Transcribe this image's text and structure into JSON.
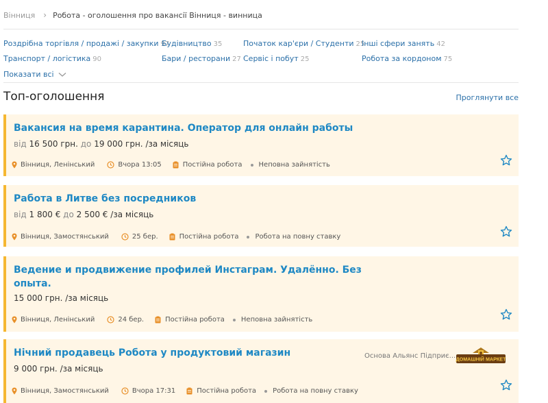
{
  "breadcrumb": {
    "city": "Вінниця",
    "current": "Робота - оголошення про вакансії Вінниця - винница"
  },
  "categories": [
    {
      "name": "Роздрібна торгівля / продажі / закупки",
      "count": "97"
    },
    {
      "name": "Будівництво",
      "count": "35"
    },
    {
      "name": "Початок кар'єри / Студенти",
      "count": "25"
    },
    {
      "name": "Інші сфери занять",
      "count": "42"
    },
    {
      "name": "Транспорт / логістика",
      "count": "90"
    },
    {
      "name": "Бари / ресторани",
      "count": "27"
    },
    {
      "name": "Сервіс і побут",
      "count": "25"
    },
    {
      "name": "Робота за кордоном",
      "count": "75"
    }
  ],
  "show_all_label": "Показати всі",
  "section": {
    "title": "Топ-оголошення",
    "view_all": "Проглянути все"
  },
  "listings": [
    {
      "title": "Вакансия на время карантина. Оператор для онлайн работы",
      "price_from_label": "від",
      "price_from": "16 500 грн.",
      "price_to_label": "до",
      "price_to": "19 000 грн.",
      "price_period": "/за місяць",
      "location": "Вінниця, Ленінський",
      "time": "Вчора 13:05",
      "job_type": "Постійна робота",
      "employment": "Неповна зайнятість"
    },
    {
      "title": "Работа в Литве без посредников",
      "price_from_label": "від",
      "price_from": "1 800 €",
      "price_to_label": "до",
      "price_to": "2 500 €",
      "price_period": "/за місяць",
      "location": "Вінниця, Замостянський",
      "time": "25 бер.",
      "job_type": "Постійна робота",
      "employment": "Робота на повну ставку"
    },
    {
      "title_line1": "Ведение и продвижение профилей Инстаграм. Удалённо. Без",
      "title_line2": "опыта.",
      "price": "15 000 грн.",
      "price_period": "/за місяць",
      "location": "Вінниця, Ленінський",
      "time": "24 бер.",
      "job_type": "Постійна робота",
      "employment": "Неповна зайнятість"
    },
    {
      "title": "Нічний продавець Робота у продуктовий магазин",
      "price": "9 000 грн.",
      "price_period": "/за місяць",
      "company": "Основа Альянс Підприє...",
      "logo_text": "ДОМАШНІЙ МАРКЕТ",
      "location": "Вінниця, Замостянський",
      "time": "Вчора 17:31",
      "job_type": "Постійна робота",
      "employment": "Робота на повну ставку"
    }
  ],
  "colors": {
    "link": "#2a6fa8",
    "title": "#1e88c4",
    "card_bg": "#fff6e6",
    "card_accent": "#f5b731",
    "icon": "#e8902a"
  },
  "icons": {
    "location": "pin-icon",
    "time": "clock-icon",
    "job_type": "clipboard-icon",
    "favorite": "star-outline-icon",
    "expand": "chevron-down-icon",
    "breadcrumb": "chevron-right-icon"
  }
}
